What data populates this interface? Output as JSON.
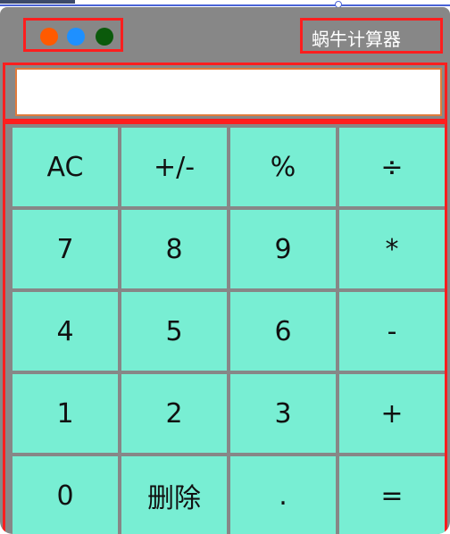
{
  "app": {
    "title": "蜗牛计算器",
    "display_value": "",
    "window_controls": [
      {
        "name": "close",
        "color": "#ff5a00"
      },
      {
        "name": "minimize",
        "color": "#1e90ff"
      },
      {
        "name": "maximize",
        "color": "#0b5a0b"
      }
    ]
  },
  "keypad": {
    "rows": [
      [
        "AC",
        "+/-",
        "%",
        "÷"
      ],
      [
        "7",
        "8",
        "9",
        "*"
      ],
      [
        "4",
        "5",
        "6",
        "-"
      ],
      [
        "1",
        "2",
        "3",
        "+"
      ],
      [
        "0",
        "删除",
        ".",
        "="
      ]
    ]
  },
  "colors": {
    "key_bg": "#78eed3",
    "window_bg": "#878787",
    "highlight_border": "#ff1e1e",
    "display_border": "#e07b3c"
  }
}
